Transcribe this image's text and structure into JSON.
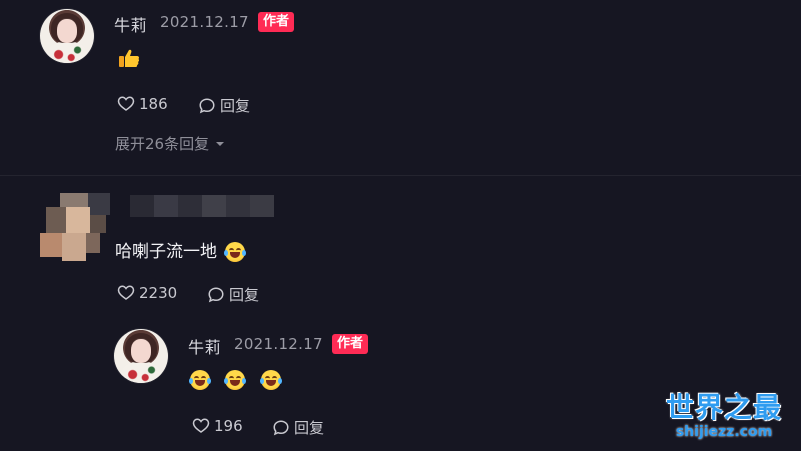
{
  "comments": [
    {
      "author": "牛莉",
      "date": "2021.12.17",
      "badge": "作者",
      "content_icon": "thumbs-up-emoji",
      "likes": "186",
      "reply_label": "回复",
      "expand_label": "展开26条回复"
    },
    {
      "author_blurred": true,
      "content": "哈喇子流一地",
      "content_icon": "rolling-laughing-emoji",
      "likes": "2230",
      "reply_label": "回复",
      "reply": {
        "author": "牛莉",
        "date": "2021.12.17",
        "badge": "作者",
        "content_icons": [
          "rolling-laughing-emoji",
          "rolling-laughing-emoji",
          "rolling-laughing-emoji"
        ],
        "likes": "196",
        "reply_label": "回复"
      }
    }
  ],
  "watermark": {
    "title": "世界之最",
    "url": "shijiezz.com"
  },
  "colors": {
    "background": "#161622",
    "badge": "#ff2b55",
    "watermark": "#2f9cf0"
  }
}
